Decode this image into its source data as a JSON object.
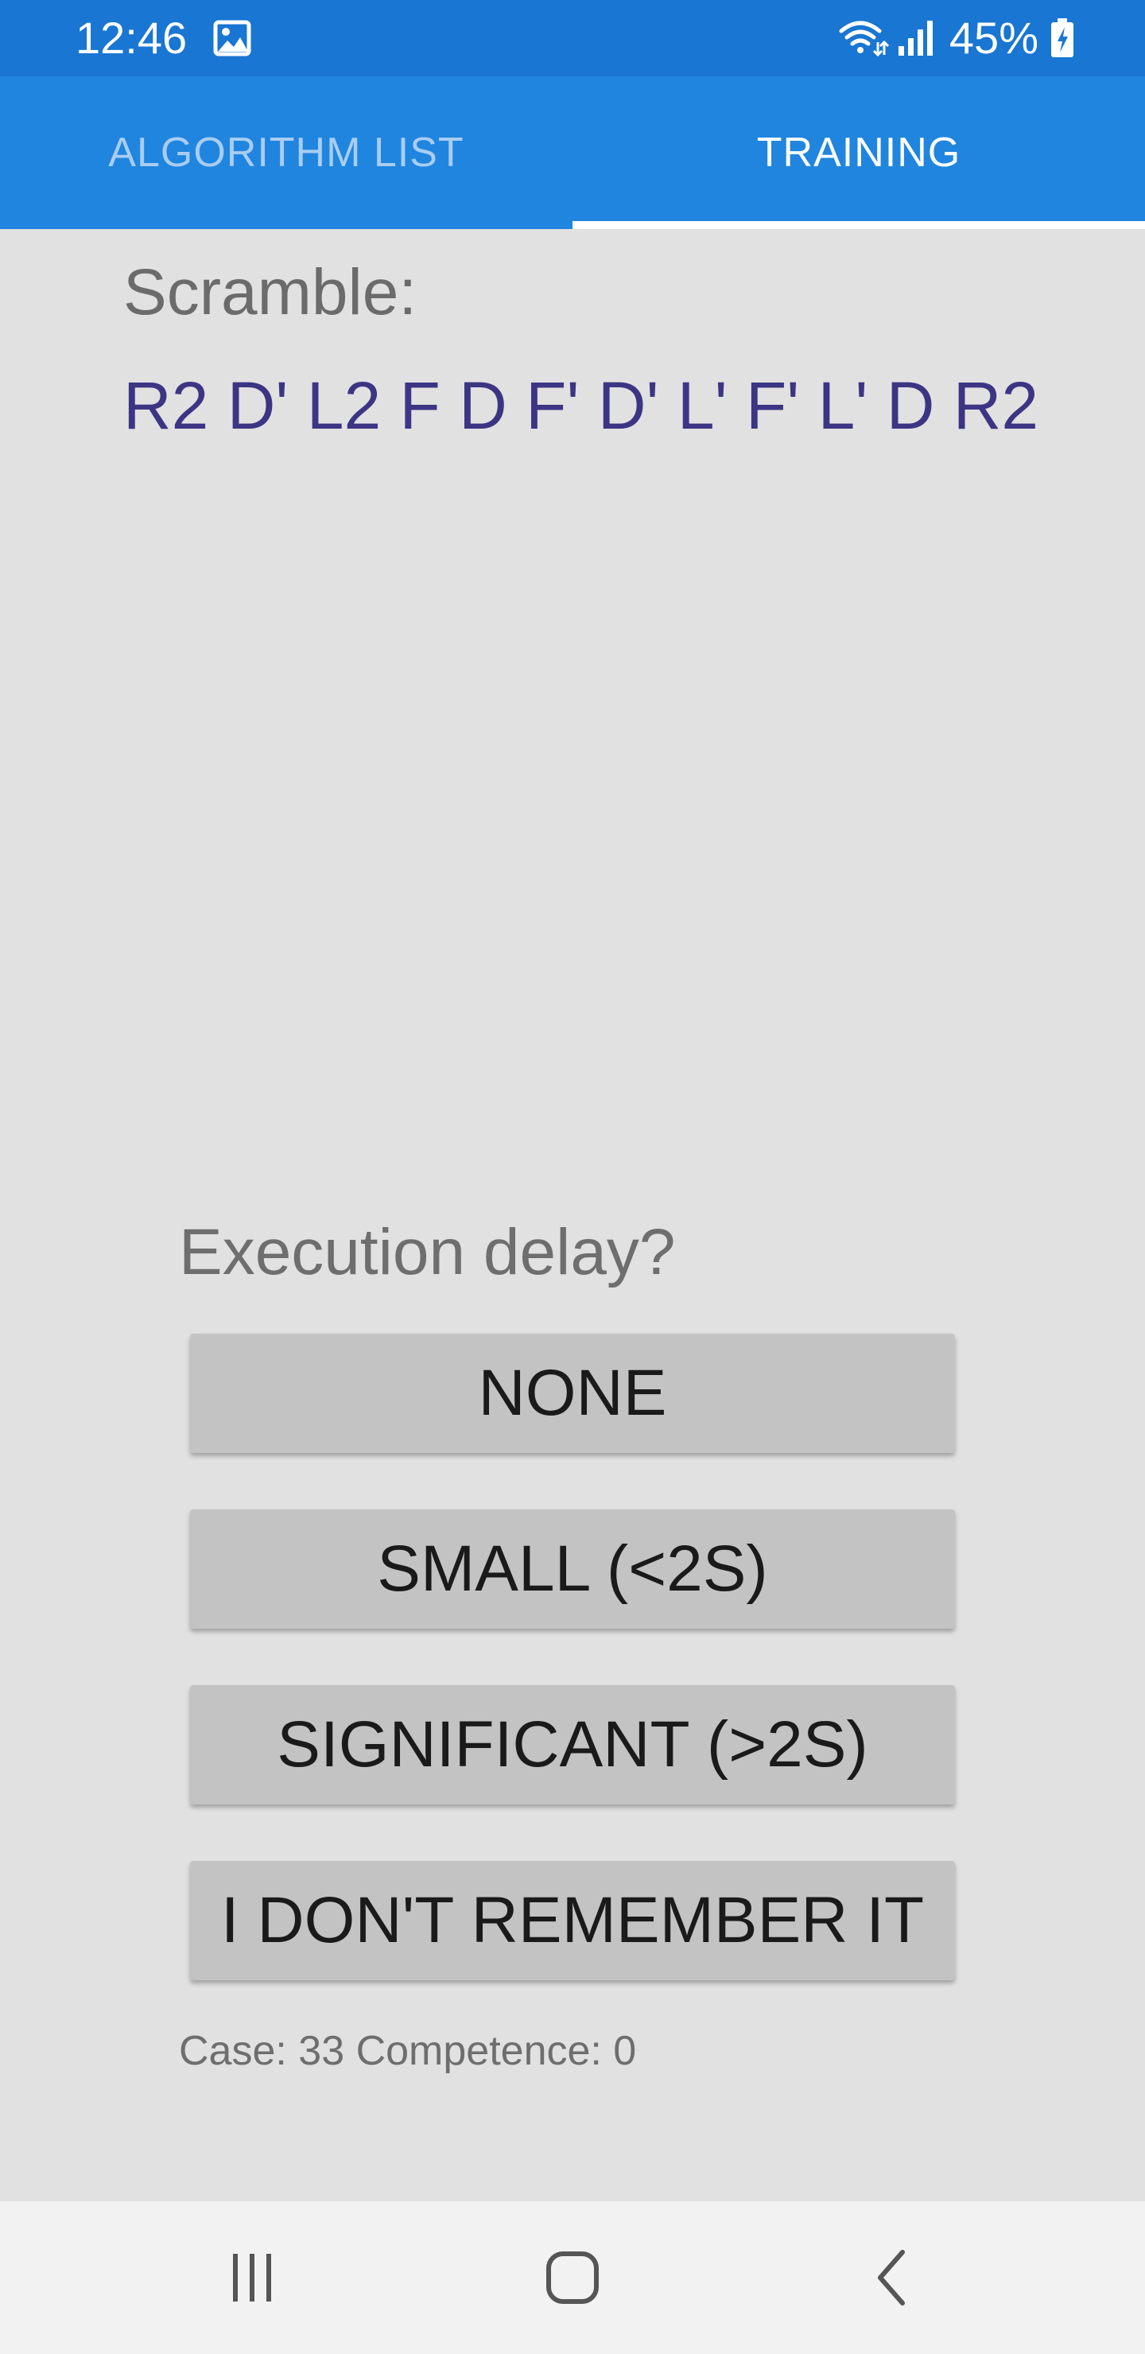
{
  "status_bar": {
    "time": "12:46",
    "battery": "45%",
    "icons": [
      "gallery-icon",
      "wifi-icon",
      "signal-icon",
      "battery-charging-icon"
    ]
  },
  "tabs": [
    {
      "label": "ALGORITHM LIST",
      "selected": false
    },
    {
      "label": "TRAINING",
      "selected": true
    }
  ],
  "scramble": {
    "label": "Scramble:",
    "moves": "R2 D' L2 F D F' D' L' F' L' D R2"
  },
  "delay": {
    "prompt": "Execution delay?",
    "options": [
      "NONE",
      "SMALL (<2S)",
      "SIGNIFICANT (>2S)",
      "I DON'T REMEMBER IT"
    ]
  },
  "case_info": "Case: 33 Competence: 0",
  "nav_bar": {
    "icons": [
      "recents-icon",
      "home-icon",
      "back-icon"
    ]
  },
  "colors": {
    "status_bar": "#1976d2",
    "tab_bar": "#2085de",
    "background": "#e1e1e1",
    "scramble_text": "#3c3584",
    "button": "#c3c3c3"
  }
}
